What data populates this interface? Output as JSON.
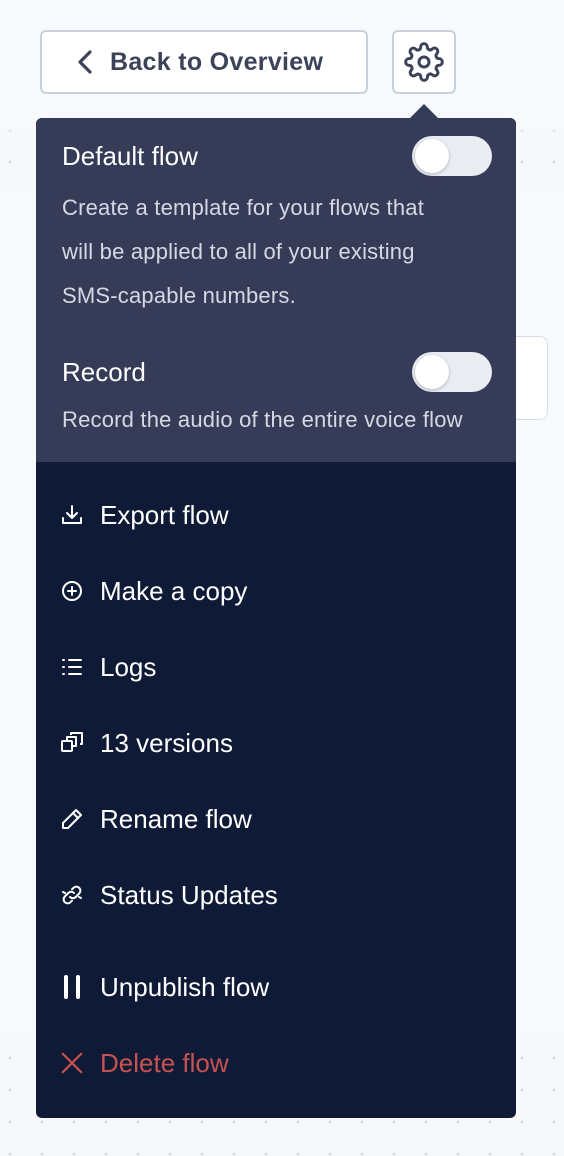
{
  "header": {
    "back_label": "Back to Overview",
    "back_icon": "chevron-left-icon",
    "settings_icon": "gear-icon"
  },
  "settings_menu": {
    "default_flow": {
      "title": "Default flow",
      "description_lines": [
        "Create a template for your flows that",
        "will be applied to all of your existing",
        "SMS-capable numbers."
      ],
      "enabled": false
    },
    "record": {
      "title": "Record",
      "description": "Record the audio of the entire voice flow",
      "enabled": false
    },
    "items": [
      {
        "label": "Export flow",
        "icon": "download-icon"
      },
      {
        "label": "Make a copy",
        "icon": "plus-circle-icon"
      },
      {
        "label": "Logs",
        "icon": "list-icon"
      },
      {
        "label": "13 versions",
        "icon": "versions-icon"
      },
      {
        "label": "Rename flow",
        "icon": "pencil-icon"
      },
      {
        "label": "Status Updates",
        "icon": "link-icon"
      },
      {
        "label": "Unpublish flow",
        "icon": "pause-icon"
      },
      {
        "label": "Delete flow",
        "icon": "close-icon"
      }
    ]
  },
  "colors": {
    "menu_bg": "#0f1a36",
    "settings_bg": "#363b58",
    "danger": "#c8524f",
    "text": "#ffffff"
  }
}
